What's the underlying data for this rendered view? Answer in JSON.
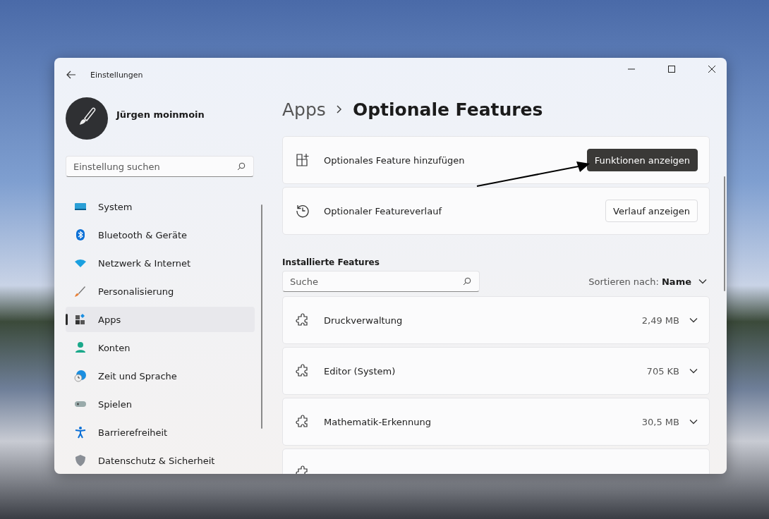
{
  "window": {
    "title": "Einstellungen"
  },
  "profile": {
    "name": "Jürgen moinmoin"
  },
  "sidebar": {
    "search": {
      "placeholder": "Einstellung suchen"
    },
    "items": [
      {
        "label": "System",
        "kind": "system",
        "selected": false
      },
      {
        "label": "Bluetooth & Geräte",
        "kind": "bluetooth",
        "selected": false
      },
      {
        "label": "Netzwerk & Internet",
        "kind": "network",
        "selected": false
      },
      {
        "label": "Personalisierung",
        "kind": "brush",
        "selected": false
      },
      {
        "label": "Apps",
        "kind": "apps",
        "selected": true
      },
      {
        "label": "Konten",
        "kind": "account",
        "selected": false
      },
      {
        "label": "Zeit und Sprache",
        "kind": "time",
        "selected": false
      },
      {
        "label": "Spielen",
        "kind": "gaming",
        "selected": false
      },
      {
        "label": "Barrierefreiheit",
        "kind": "accessibility",
        "selected": false
      },
      {
        "label": "Datenschutz & Sicherheit",
        "kind": "shield",
        "selected": false
      }
    ]
  },
  "breadcrumb": [
    {
      "label": "Apps",
      "current": false
    },
    {
      "label": "Optionale Features",
      "current": true
    }
  ],
  "actions": [
    {
      "label": "Optionales Feature hinzufügen",
      "kind": "add",
      "button": "Funktionen anzeigen",
      "primary": true
    },
    {
      "label": "Optionaler Featureverlauf",
      "kind": "history",
      "button": "Verlauf anzeigen",
      "primary": false
    }
  ],
  "installed": {
    "heading": "Installierte Features",
    "search": {
      "placeholder": "Suche"
    },
    "sort": "Sortieren nach: **Name**",
    "rows": [
      {
        "name": "Druckverwaltung",
        "size": "2,49 MB"
      },
      {
        "name": "Editor (System)",
        "size": "705 KB"
      },
      {
        "name": "Mathematik-Erkennung",
        "size": "30,5 MB"
      }
    ]
  }
}
